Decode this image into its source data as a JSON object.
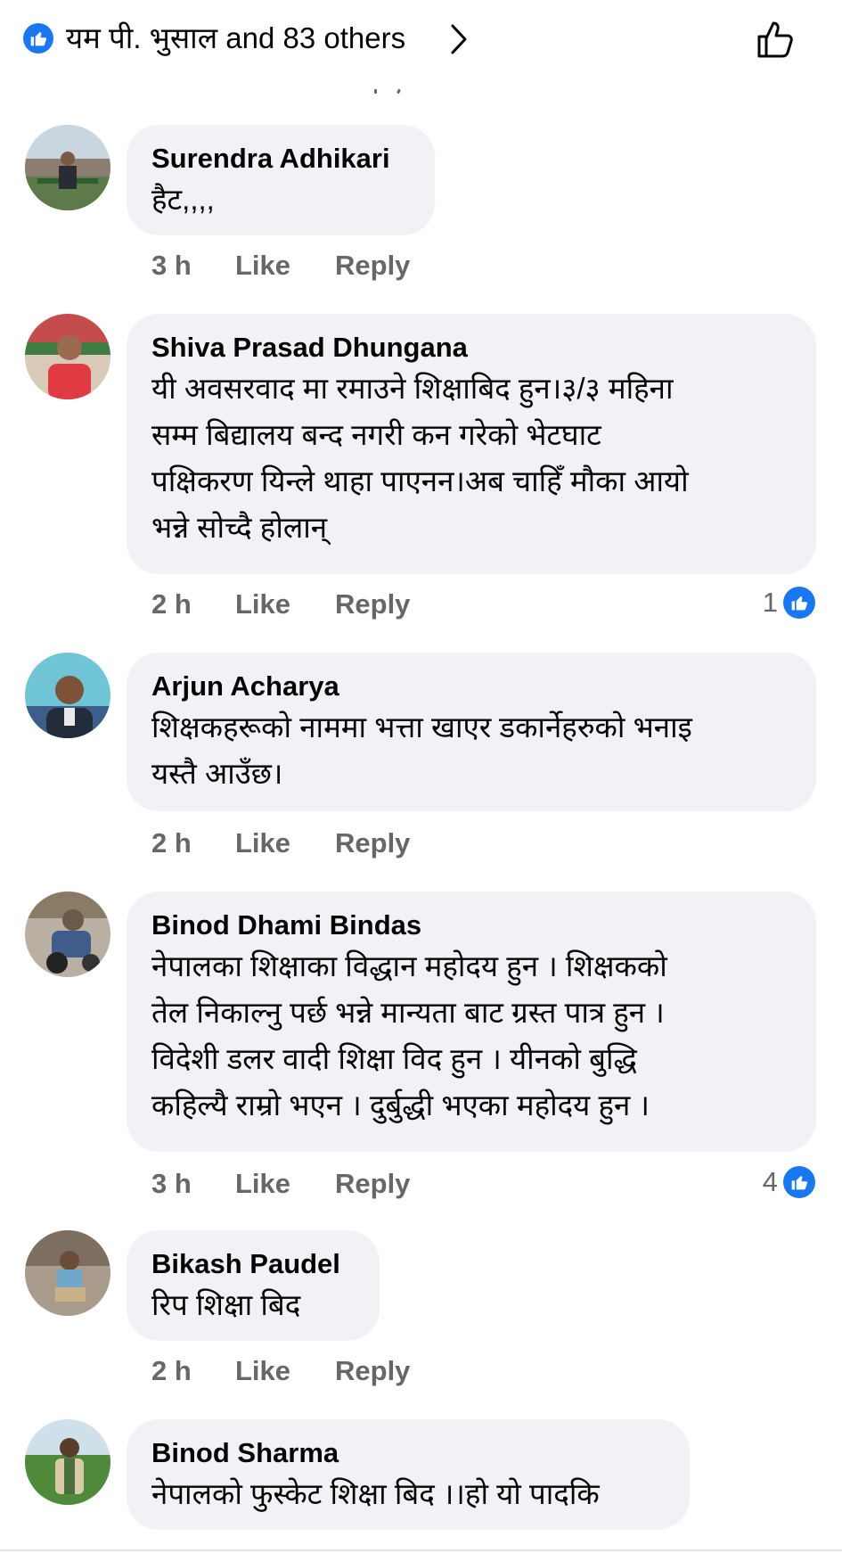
{
  "header": {
    "reactors_text": "यम पी. भुसाल and 83 others",
    "reaction_icon": "like-icon",
    "action_icon": "thumbs-up-outline-icon",
    "accent": "#1877f2"
  },
  "comments": [
    {
      "author": "Surendra Adhikari",
      "lines": [
        "हैट,,,,"
      ],
      "time": "3 h",
      "like": "Like",
      "reply": "Reply",
      "reactions": ""
    },
    {
      "author": "Shiva Prasad Dhungana",
      "lines": [
        "यी अवसरवाद मा रमाउने शिक्षाबिद हुन।३/३ महिना",
        "सम्म बिद्यालय बन्द नगरी कन गरेको भेटघाट",
        "पक्षिकरण यिन्ले थाहा पाएनन।अब चाहिँ मौका आयो",
        "भन्ने सोच्दै होलान्"
      ],
      "time": "2 h",
      "like": "Like",
      "reply": "Reply",
      "reactions": "1"
    },
    {
      "author": "Arjun Acharya",
      "lines": [
        "शिक्षकहरूको नाममा भत्ता खाएर डकार्नेहरुको भनाइ",
        "यस्तै आउँछ।"
      ],
      "time": "2 h",
      "like": "Like",
      "reply": "Reply",
      "reactions": ""
    },
    {
      "author": "Binod Dhami Bindas",
      "lines": [
        "नेपालका शिक्षाका विद्धान महोदय हुन । शिक्षकको",
        "तेल निकाल्नु पर्छ भन्ने मान्यता बाट ग्रस्त पात्र हुन ।",
        "विदेशी डलर वादी शिक्षा विद हुन । यीनको बुद्धि",
        "कहिल्यै राम्रो भएन । दुर्बुद्धी भएका महोदय हुन ।"
      ],
      "time": "3 h",
      "like": "Like",
      "reply": "Reply",
      "reactions": "4"
    },
    {
      "author": "Bikash Paudel",
      "lines": [
        "रिप शिक्षा बिद"
      ],
      "time": "2 h",
      "like": "Like",
      "reply": "Reply",
      "reactions": ""
    },
    {
      "author": "Binod Sharma",
      "lines": [
        "नेपालको फुस्केट शिक्षा बिद ।।हो यो पादकि"
      ],
      "time": "",
      "like": "",
      "reply": "",
      "reactions": ""
    }
  ]
}
